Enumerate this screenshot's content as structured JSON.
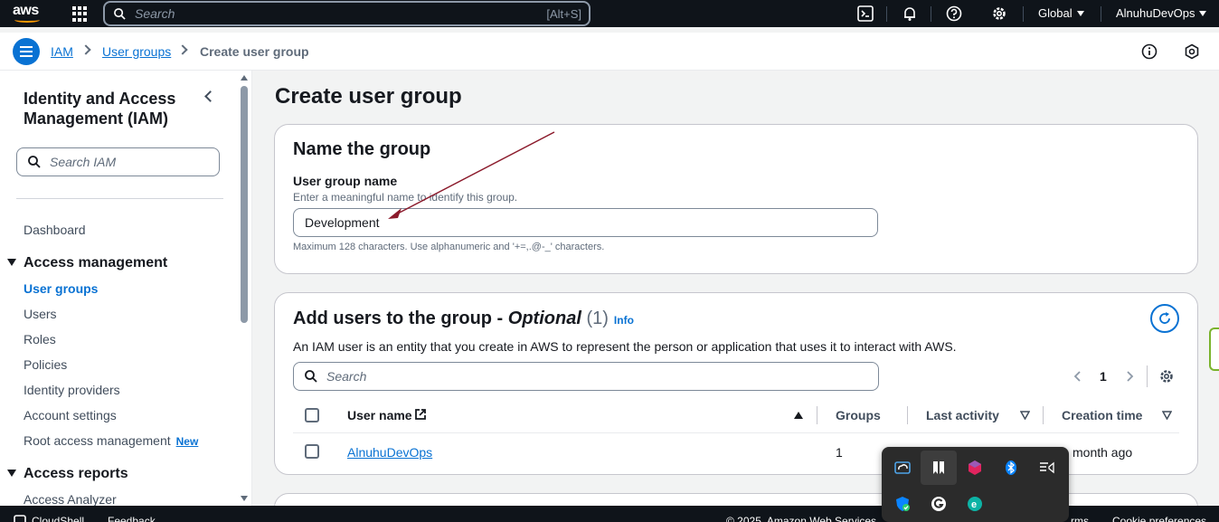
{
  "topbar": {
    "logo_text": "aws",
    "search_placeholder": "Search",
    "search_shortcut": "[Alt+S]",
    "region": "Global",
    "account": "AlnuhuDevOps"
  },
  "breadcrumb": {
    "items": [
      "IAM",
      "User groups"
    ],
    "current": "Create user group"
  },
  "sidebar": {
    "title": "Identity and Access Management (IAM)",
    "search_placeholder": "Search IAM",
    "dashboard": "Dashboard",
    "access_management": {
      "heading": "Access management",
      "items": [
        "User groups",
        "Users",
        "Roles",
        "Policies",
        "Identity providers",
        "Account settings",
        "Root access management"
      ],
      "new_badge": "New"
    },
    "access_reports": {
      "heading": "Access reports",
      "items": [
        "Access Analyzer"
      ]
    }
  },
  "page": {
    "title": "Create user group",
    "name_card": {
      "heading": "Name the group",
      "field_label": "User group name",
      "field_description": "Enter a meaningful name to identify this group.",
      "field_value": "Development",
      "constraint": "Maximum 128 characters. Use alphanumeric and '+=,.@-_' characters."
    },
    "users_card": {
      "heading_main": "Add users to the group - ",
      "heading_optional": "Optional",
      "heading_count": "(1)",
      "info": "Info",
      "description": "An IAM user is an entity that you create in AWS to represent the person or application that uses it to interact with AWS.",
      "search_placeholder": "Search",
      "page_number": "1",
      "columns": [
        "User name",
        "Groups",
        "Last activity",
        "Creation time"
      ],
      "rows": [
        {
          "user_name": "AlnuhuDevOps",
          "groups": "1",
          "creation_time": "month ago"
        }
      ]
    }
  },
  "footer": {
    "cloudshell": "CloudShell",
    "feedback": "Feedback",
    "copyright": "© 2025, Amazon Web Services",
    "terms": "rms",
    "cookie": "Cookie preferences"
  },
  "colors": {
    "accent": "#0972d3",
    "topbar": "#0f141a",
    "annotation_arrow": "#8b1a2b"
  }
}
